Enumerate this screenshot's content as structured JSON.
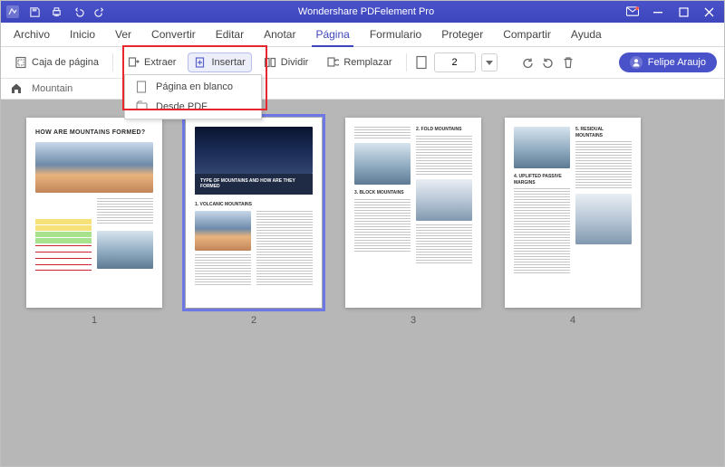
{
  "app": {
    "title": "Wondershare PDFelement Pro"
  },
  "menu": {
    "items": [
      "Archivo",
      "Inicio",
      "Ver",
      "Convertir",
      "Editar",
      "Anotar",
      "Página",
      "Formulario",
      "Proteger",
      "Compartir",
      "Ayuda"
    ],
    "active_index": 6
  },
  "toolbar": {
    "page_box": "Caja de página",
    "extract": "Extraer",
    "insert": "Insertar",
    "split": "Dividir",
    "replace": "Remplazar",
    "page_input": "2",
    "insert_menu": {
      "blank": "Página en blanco",
      "from_pdf": "Desde PDF"
    }
  },
  "user": {
    "name": "Felipe Araujo"
  },
  "breadcrumb": {
    "doc": "Mountain"
  },
  "thumbs": {
    "labels": [
      "1",
      "2",
      "3",
      "4"
    ],
    "selected_index": 1,
    "p1_title": "HOW ARE MOUNTAINS FORMED?",
    "p2_caption": "TYPE OF MOUNTAINS AND HOW ARE THEY FORMED",
    "p2_h1": "1. VOLCANIC MOUNTAINS",
    "p3_h1": "2. FOLD MOUNTAINS",
    "p3_h2": "3. BLOCK MOUNTAINS",
    "p4_h1": "4. UPLIFTED PASSIVE MARGINS",
    "p4_h2": "5. RESIDUAL MOUNTAINS"
  }
}
